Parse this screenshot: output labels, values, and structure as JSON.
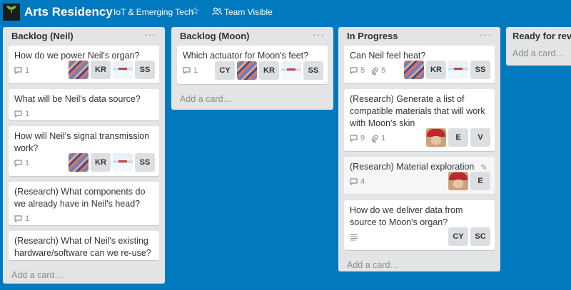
{
  "header": {
    "board_title": "Arts Residency",
    "team_name": "IoT & Emerging Tech",
    "visibility": "Team Visible"
  },
  "colors": {
    "background": "#0079bf",
    "list": "#e2e4e6",
    "card": "#ffffff"
  },
  "add_card_label": "Add a card…",
  "lists": [
    {
      "title": "Backlog (Neil)",
      "cards": [
        {
          "title": "How do we power Neil's organ?",
          "comments": "1",
          "members": [
            "",
            "KR",
            "",
            "SS"
          ]
        },
        {
          "title": "What will be Neil's data source?",
          "comments": "1"
        },
        {
          "title": "How will Neil's signal transmission work?",
          "comments": "1",
          "members": [
            "",
            "KR",
            "",
            "SS"
          ]
        },
        {
          "title": "(Research) What components do we already have in Neil's head?",
          "comments": "1"
        },
        {
          "title": "(Research) What of Neil's existing hardware/software can we re-use?"
        }
      ]
    },
    {
      "title": "Backlog (Moon)",
      "cards": [
        {
          "title": "Which actuator for Moon's feet?",
          "comments": "1",
          "members": [
            "CY",
            "",
            "KR",
            "",
            "SS"
          ]
        }
      ]
    },
    {
      "title": "In Progress",
      "cards": [
        {
          "title": "Can Neil feel heat?",
          "comments": "5",
          "attachments": "5",
          "members": [
            "",
            "KR",
            "",
            "SS"
          ]
        },
        {
          "title": "(Research) Generate a list of compatible materials that will work with Moon's skin",
          "comments": "9",
          "attachments": "1",
          "members": [
            "",
            "E",
            "V"
          ]
        },
        {
          "title": "(Research) Material exploration",
          "comments": "4",
          "members": [
            "",
            "E"
          ]
        },
        {
          "title": "How do we deliver data from source to Moon's organ?",
          "members": [
            "CY",
            "SC"
          ]
        }
      ]
    },
    {
      "title": "Ready for revie"
    }
  ]
}
